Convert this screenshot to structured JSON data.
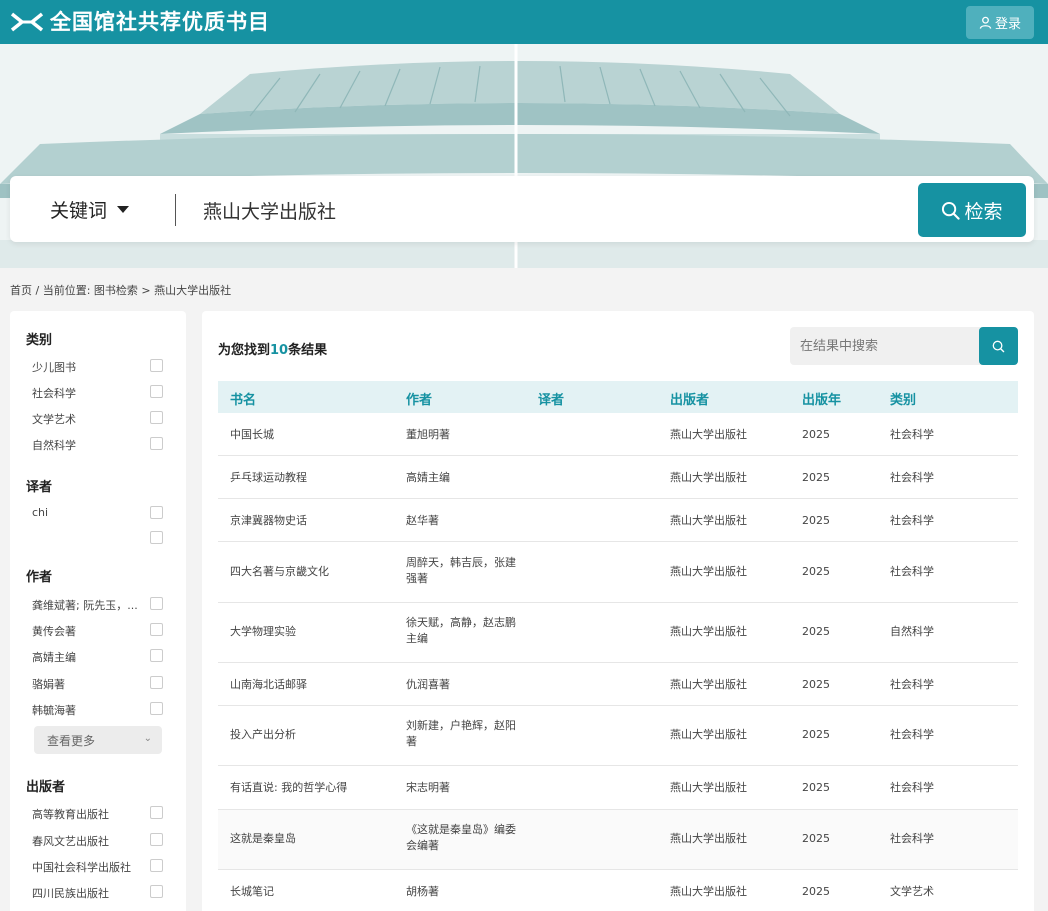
{
  "header": {
    "logo_text": "全国馆社共荐优质书目",
    "login_label": "登录"
  },
  "search": {
    "type_label": "关键词",
    "query": "燕山大学出版社",
    "button_label": "检索"
  },
  "breadcrumb": "首页 / 当前位置: 图书检索 > 燕山大学出版社",
  "facets": {
    "category": {
      "title": "类别",
      "items": [
        "少儿图书",
        "社会科学",
        "文学艺术",
        "自然科学"
      ]
    },
    "translator": {
      "title": "译者",
      "items": [
        "chi",
        ""
      ]
    },
    "author": {
      "title": "作者",
      "items": [
        "龚维斌著; 阮先玉，...",
        "黄传会著",
        "高婧主编",
        "骆娟著",
        "韩毓海著"
      ],
      "more_label": "查看更多"
    },
    "publisher": {
      "title": "出版者",
      "items": [
        "高等教育出版社",
        "春风文艺出版社",
        "中国社会科学出版社",
        "四川民族出版社"
      ]
    }
  },
  "results": {
    "prefix": "为您找到",
    "count": "10",
    "suffix": "条结果",
    "inner_search_placeholder": "在结果中搜索",
    "columns": [
      "书名",
      "作者",
      "译者",
      "出版者",
      "出版年",
      "类别"
    ],
    "rows": [
      {
        "title": "中国长城",
        "author": "董旭明著",
        "translator": "",
        "publisher": "燕山大学出版社",
        "year": "2025",
        "category": "社会科学"
      },
      {
        "title": "乒乓球运动教程",
        "author": "高婧主编",
        "translator": "",
        "publisher": "燕山大学出版社",
        "year": "2025",
        "category": "社会科学"
      },
      {
        "title": "京津冀器物史话",
        "author": "赵华著",
        "translator": "",
        "publisher": "燕山大学出版社",
        "year": "2025",
        "category": "社会科学"
      },
      {
        "title": "四大名著与京畿文化",
        "author": "周醉天，韩吉辰，张建强著",
        "translator": "",
        "publisher": "燕山大学出版社",
        "year": "2025",
        "category": "社会科学"
      },
      {
        "title": "大学物理实验",
        "author": "徐天赋，高静，赵志鹏主编",
        "translator": "",
        "publisher": "燕山大学出版社",
        "year": "2025",
        "category": "自然科学"
      },
      {
        "title": "山南海北话邮驿",
        "author": "仇润喜著",
        "translator": "",
        "publisher": "燕山大学出版社",
        "year": "2025",
        "category": "社会科学"
      },
      {
        "title": "投入产出分析",
        "author": "刘新建，户艳辉，赵阳著",
        "translator": "",
        "publisher": "燕山大学出版社",
        "year": "2025",
        "category": "社会科学"
      },
      {
        "title": "有话直说: 我的哲学心得",
        "author": "宋志明著",
        "translator": "",
        "publisher": "燕山大学出版社",
        "year": "2025",
        "category": "社会科学"
      },
      {
        "title": "这就是秦皇岛",
        "author": "《这就是秦皇岛》编委会编著",
        "translator": "",
        "publisher": "燕山大学出版社",
        "year": "2025",
        "category": "社会科学"
      },
      {
        "title": "长城笔记",
        "author": "胡杨著",
        "translator": "",
        "publisher": "燕山大学出版社",
        "year": "2025",
        "category": "文学艺术"
      }
    ]
  },
  "colors": {
    "brand": "#1692a2",
    "header_tint": "#e3f2f4"
  }
}
